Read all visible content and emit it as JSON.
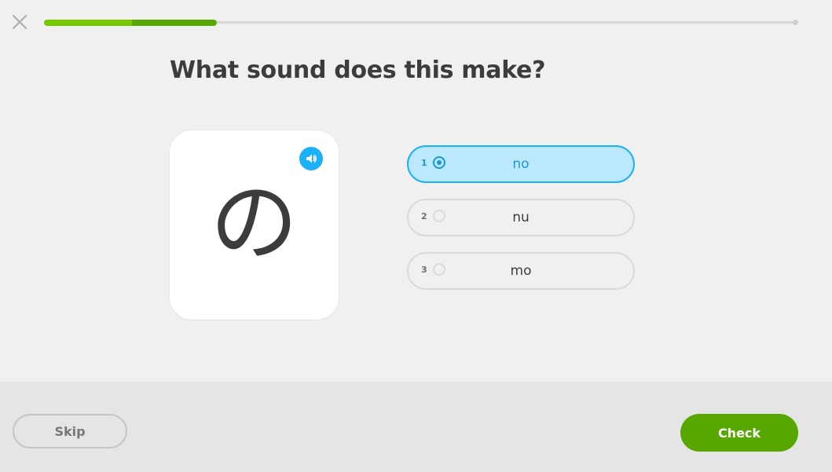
{
  "header": {
    "close_icon": "close-icon",
    "progress": 0.23
  },
  "prompt": {
    "title": "What sound does this make?"
  },
  "card": {
    "character": "の",
    "audio_icon": "speaker-icon",
    "audio_color": "#1cb0f6"
  },
  "choices": [
    {
      "number": "1",
      "label": "no",
      "selected": true
    },
    {
      "number": "2",
      "label": "nu",
      "selected": false
    },
    {
      "number": "3",
      "label": "mo",
      "selected": false
    }
  ],
  "footer": {
    "skip_label": "Skip",
    "check_label": "Check"
  },
  "colors": {
    "accent_green": "#58a700",
    "progress_green": "#78c800",
    "selected_blue": "#1cb0f6",
    "selected_bg": "#bce8fd"
  }
}
